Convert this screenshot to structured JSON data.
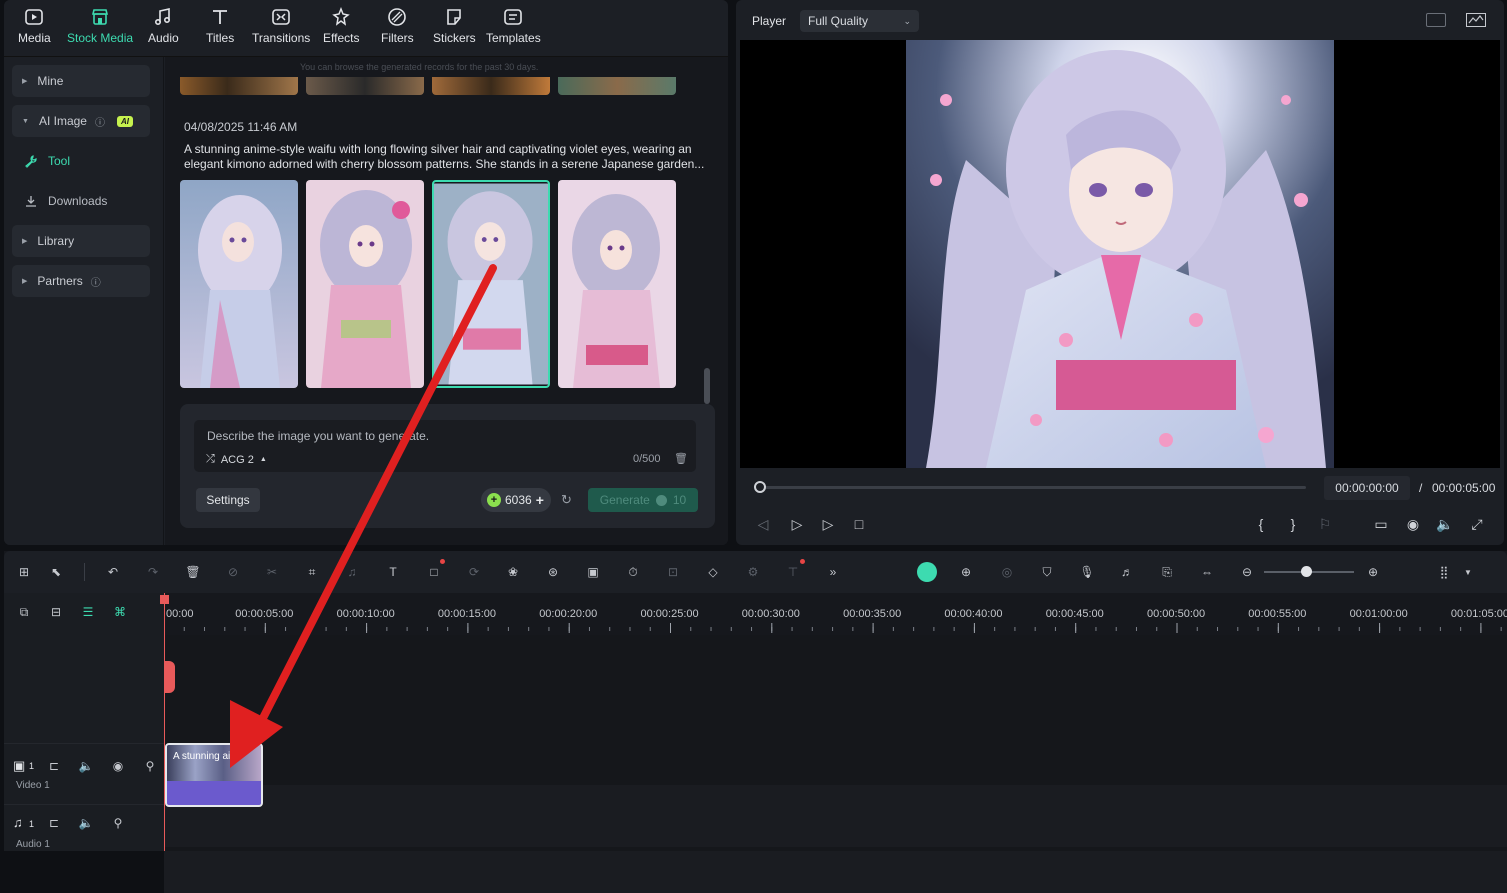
{
  "toolbar": {
    "items": [
      {
        "label": "Media",
        "icon": "media-icon"
      },
      {
        "label": "Stock Media",
        "icon": "stock-media-icon",
        "active": true
      },
      {
        "label": "Audio",
        "icon": "audio-icon"
      },
      {
        "label": "Titles",
        "icon": "titles-icon"
      },
      {
        "label": "Transitions",
        "icon": "transitions-icon"
      },
      {
        "label": "Effects",
        "icon": "effects-icon"
      },
      {
        "label": "Filters",
        "icon": "filters-icon"
      },
      {
        "label": "Stickers",
        "icon": "stickers-icon"
      },
      {
        "label": "Templates",
        "icon": "templates-icon"
      }
    ]
  },
  "sidebar": {
    "mine": "Mine",
    "ai_image": "AI Image",
    "ai_badge": "AI",
    "tool": "Tool",
    "downloads": "Downloads",
    "library": "Library",
    "partners": "Partners"
  },
  "content": {
    "notice": "You can browse the generated records for the past 30 days.",
    "record_date": "04/08/2025 11:46 AM",
    "record_prompt": "A stunning anime-style waifu with long flowing silver hair and captivating violet eyes, wearing an elegant kimono adorned with cherry blossom patterns. She stands in a serene Japanese garden..."
  },
  "prompt": {
    "placeholder": "Describe the image you want to generate.",
    "model": "ACG 2",
    "counter": "0/500",
    "settings": "Settings",
    "credits": "6036",
    "generate": "Generate",
    "generate_cost": "10"
  },
  "player": {
    "label": "Player",
    "quality": "Full Quality",
    "current_time": "00:00:00:00",
    "separator": "/",
    "total_time": "00:00:05:00"
  },
  "timeline": {
    "ruler": [
      "00:00",
      "00:00:05:00",
      "00:00:10:00",
      "00:00:15:00",
      "00:00:20:00",
      "00:00:25:00",
      "00:00:30:00",
      "00:00:35:00",
      "00:00:40:00",
      "00:00:45:00",
      "00:00:50:00",
      "00:00:55:00",
      "00:01:00:00",
      "00:01:05:00"
    ],
    "video_track_num": "1",
    "video_track": "Video 1",
    "audio_track_num": "1",
    "audio_track": "Audio 1",
    "clip_label": "A stunning ai..."
  },
  "colors": {
    "accent": "#3ddbb0",
    "arrow": "#e02020",
    "clip": "#6b5acd",
    "playhead": "#e85a5a"
  }
}
